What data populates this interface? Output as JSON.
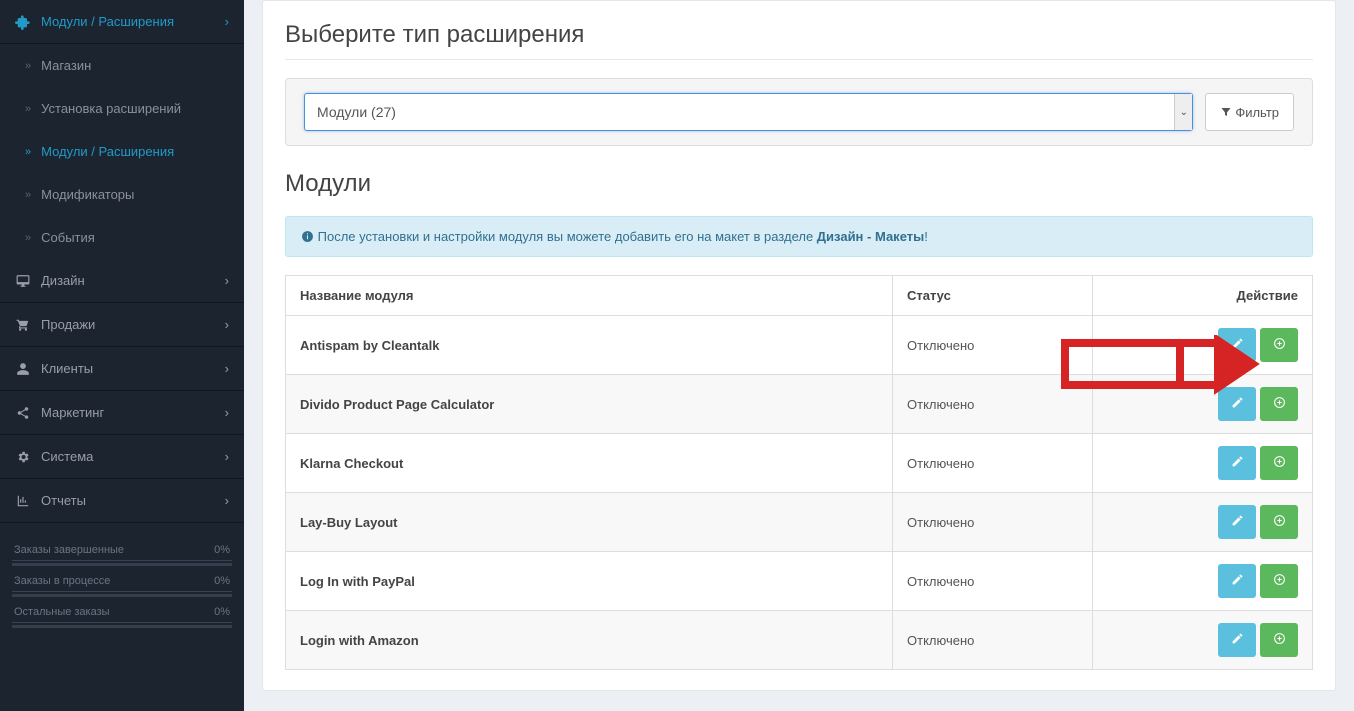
{
  "sidebar": {
    "main": {
      "label": "Модули / Расширения"
    },
    "children": [
      {
        "label": "Магазин"
      },
      {
        "label": "Установка расширений"
      },
      {
        "label": "Модули / Расширения"
      },
      {
        "label": "Модификаторы"
      },
      {
        "label": "События"
      }
    ],
    "items": [
      {
        "icon": "desktop",
        "label": "Дизайн"
      },
      {
        "icon": "cart",
        "label": "Продажи"
      },
      {
        "icon": "user",
        "label": "Клиенты"
      },
      {
        "icon": "share",
        "label": "Маркетинг"
      },
      {
        "icon": "gear",
        "label": "Система"
      },
      {
        "icon": "bars",
        "label": "Отчеты"
      }
    ],
    "stats": [
      {
        "label": "Заказы завершенные",
        "value": "0%"
      },
      {
        "label": "Заказы в процессе",
        "value": "0%"
      },
      {
        "label": "Остальные заказы",
        "value": "0%"
      }
    ]
  },
  "page": {
    "title": "Выберите тип расширения",
    "select_value": "Модули (27)",
    "filter_label": "Фильтр",
    "sub_title": "Модули",
    "alert_prefix": "После установки и настройки модуля вы можете добавить его на макет в разделе ",
    "alert_bold": "Дизайн - Макеты",
    "alert_suffix": "!"
  },
  "table": {
    "headers": {
      "name": "Название модуля",
      "status": "Статус",
      "action": "Действие"
    },
    "rows": [
      {
        "name": "Antispam by Cleantalk",
        "status": "Отключено"
      },
      {
        "name": "Divido Product Page Calculator",
        "status": "Отключено"
      },
      {
        "name": "Klarna Checkout",
        "status": "Отключено"
      },
      {
        "name": "Lay-Buy Layout",
        "status": "Отключено"
      },
      {
        "name": "Log In with PayPal",
        "status": "Отключено"
      },
      {
        "name": "Login with Amazon",
        "status": "Отключено"
      }
    ]
  }
}
